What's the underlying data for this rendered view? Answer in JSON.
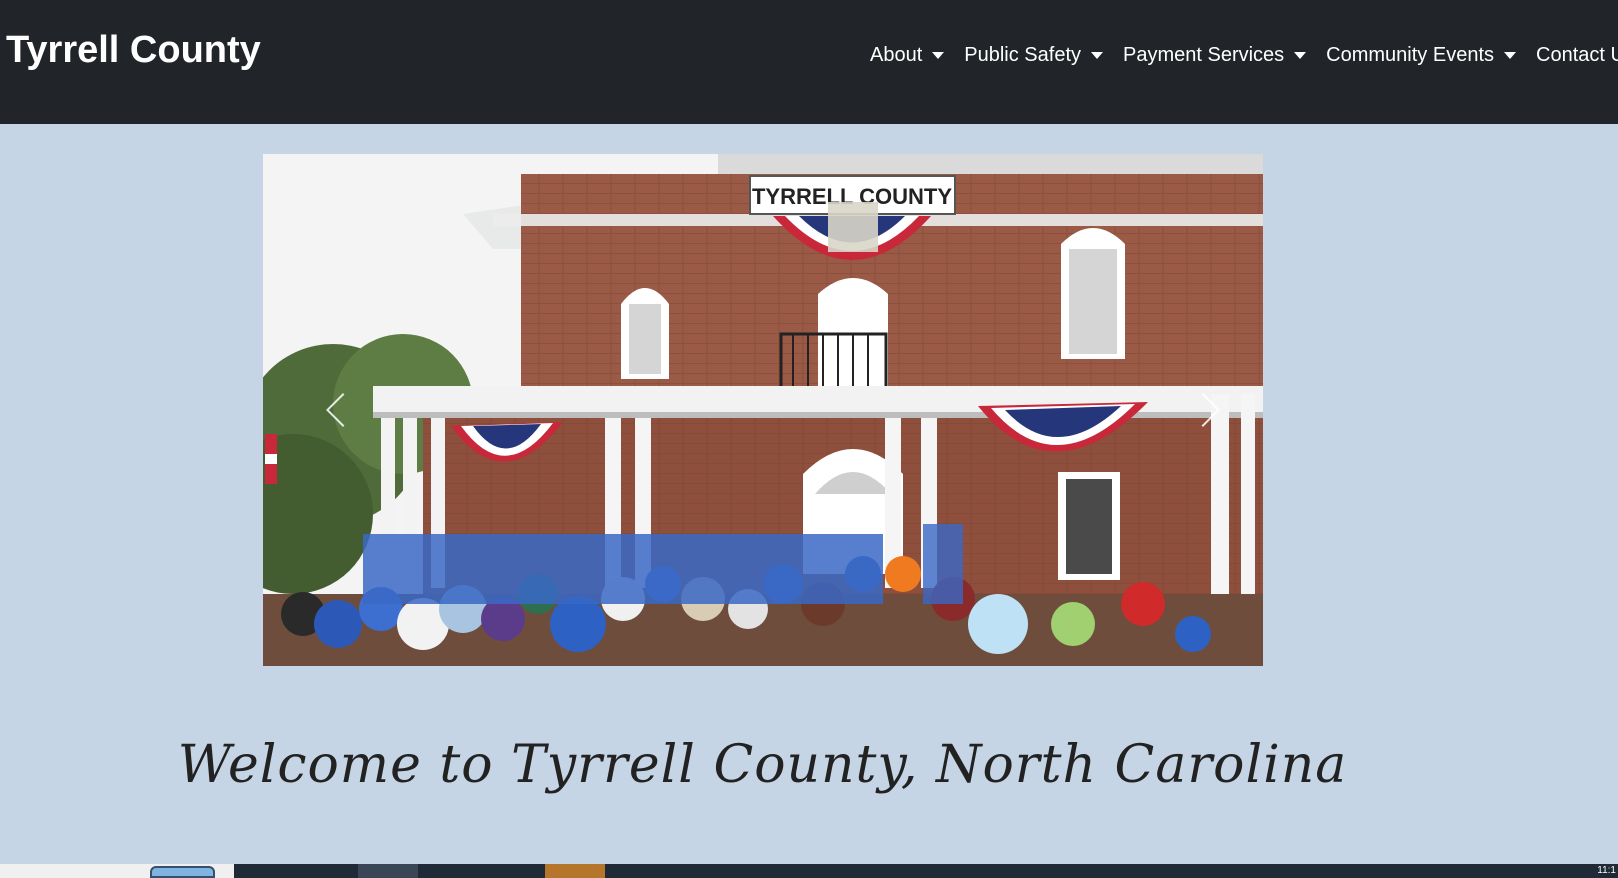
{
  "brand": {
    "title": "Tyrrell County"
  },
  "nav": {
    "items": [
      {
        "label": "About"
      },
      {
        "label": "Public Safety"
      },
      {
        "label": "Payment Services"
      },
      {
        "label": "Community Events"
      },
      {
        "label": "Contact Us"
      }
    ]
  },
  "carousel": {
    "sign_text": "TYRRELL COUNTY"
  },
  "welcome": {
    "heading": "Welcome to Tyrrell County, North Carolina"
  },
  "taskbar": {
    "clock": "11:1"
  },
  "colors": {
    "navbar": "#212529",
    "page_background": "#c5d5e5",
    "brick": "#9a5a46",
    "bunting_red": "#c8283a",
    "bunting_blue": "#26367a"
  }
}
